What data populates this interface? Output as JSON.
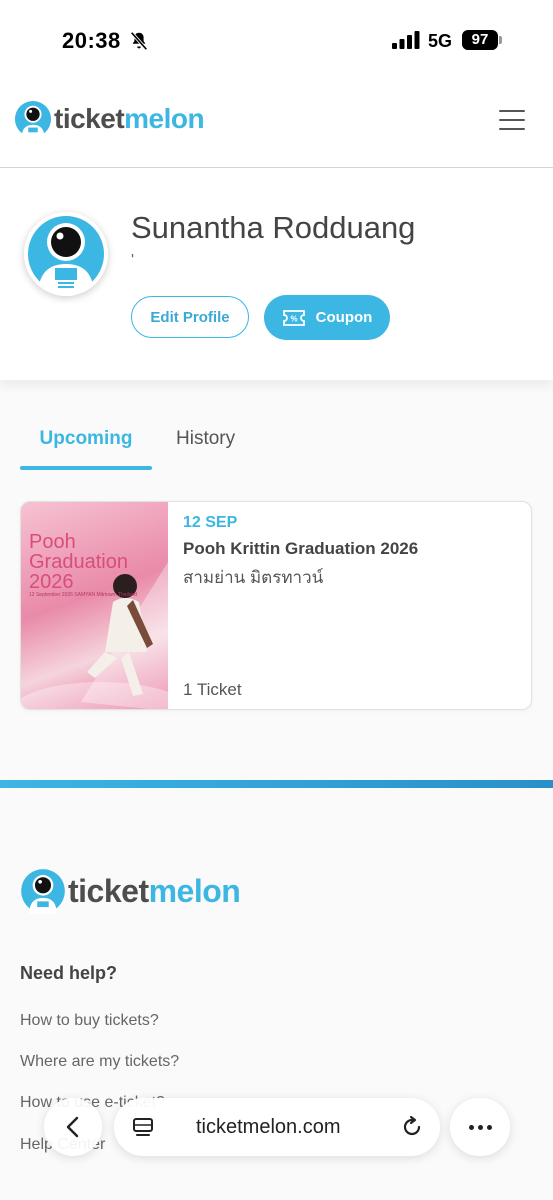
{
  "status_bar": {
    "time": "20:38",
    "network": "5G",
    "battery": "97"
  },
  "header": {
    "logo_part1": "ticket",
    "logo_part2": "melon"
  },
  "profile": {
    "name": "Sunantha Rodduang",
    "subtitle": "'",
    "edit_label": "Edit Profile",
    "coupon_label": "Coupon"
  },
  "tabs": [
    {
      "label": "Upcoming",
      "active": true
    },
    {
      "label": "History",
      "active": false
    }
  ],
  "events": [
    {
      "date": "12 SEP",
      "title": "Pooh Krittin Graduation 2026",
      "venue": "สามย่าน มิตรทาวน์",
      "tickets": "1 Ticket",
      "poster_title": "Pooh Graduation 2026",
      "poster_small": "12 September 2026 SAMYAN Mitrtown, Thailand"
    }
  ],
  "footer": {
    "need_help": "Need help?",
    "links": [
      "How to buy tickets?",
      "Where are my tickets?",
      "How to use e-ticket?",
      "Help Center"
    ]
  },
  "browser": {
    "url": "ticketmelon.com"
  },
  "colors": {
    "brand": "#3cb6e3",
    "text": "#444444"
  },
  "icons": {
    "status": [
      "bell-slash-icon",
      "signal-icon"
    ],
    "header": [
      "astronaut-logo-icon",
      "hamburger-menu-icon"
    ],
    "coupon": "coupon-ticket-icon",
    "browser": [
      "back-chevron-icon",
      "tabs-icon",
      "reload-icon",
      "more-dots-icon"
    ]
  }
}
